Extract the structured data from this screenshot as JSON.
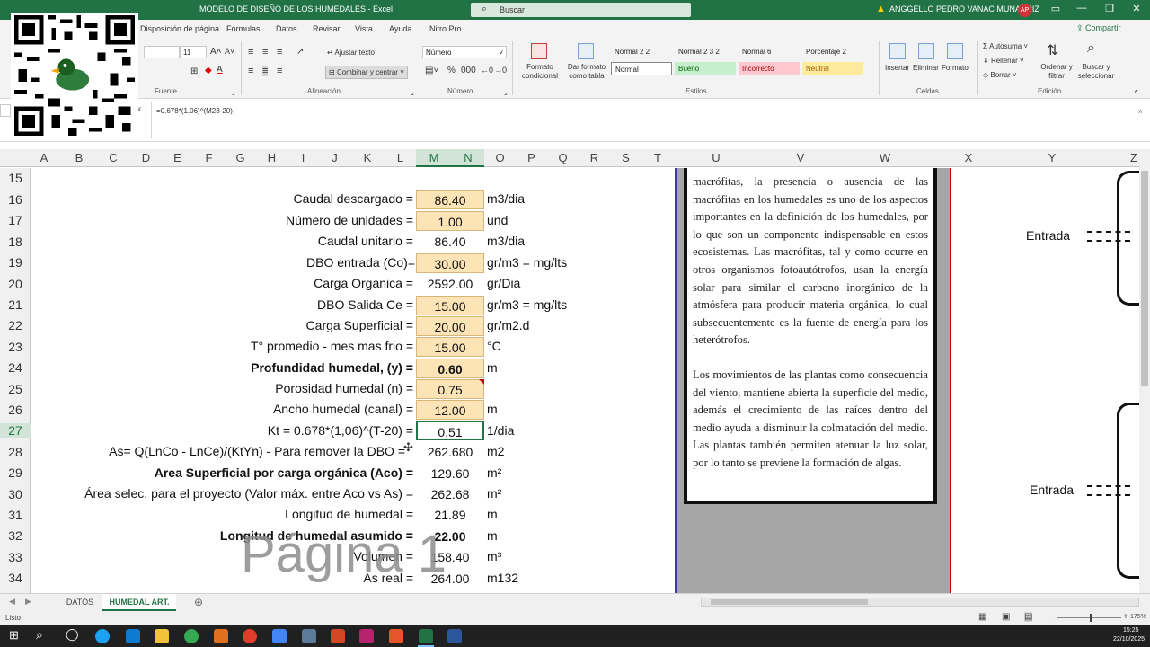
{
  "titlebar": {
    "title": "MODELO DE DISEÑO DE LOS HUMEDALES  -  Excel",
    "search": "Buscar",
    "user": "ANGGELLO PEDRO VANAC MUNARRIZ",
    "avatar": "AP"
  },
  "menu": [
    "Disposición de página",
    "Fórmulas",
    "Datos",
    "Revisar",
    "Vista",
    "Ayuda",
    "Nitro Pro"
  ],
  "share": "Compartir",
  "ribbon": {
    "font_size": "11",
    "fuente": "Fuente",
    "alineacion": "Alineación",
    "ajustar": "Ajustar texto",
    "combinar": "Combinar y centrar",
    "numero_format": "Número",
    "numero": "Número",
    "formato_condicional": "Formato condicional",
    "dar_formato": "Dar formato como tabla",
    "styles_top": [
      "Normal 2 2",
      "Normal 2 3 2",
      "Normal 6",
      "Porcentaje 2"
    ],
    "styles_bottom": [
      "Normal",
      "Bueno",
      "Incorrecto",
      "Neutral"
    ],
    "estilos": "Estilos",
    "insertar": "Insertar",
    "eliminar": "Eliminar",
    "formato": "Formato",
    "celdas": "Celdas",
    "autosuma": "Autosuma",
    "rellenar": "Rellenar",
    "borrar": "Borrar",
    "ordenar": "Ordenar y filtrar",
    "buscar": "Buscar y seleccionar",
    "edicion": "Edición"
  },
  "formula": "=0.678*(1.06)^(M23-20)",
  "columns": [
    "A",
    "B",
    "C",
    "D",
    "E",
    "F",
    "G",
    "H",
    "I",
    "J",
    "K",
    "L",
    "M",
    "N",
    "O",
    "P",
    "Q",
    "R",
    "S",
    "T",
    "U",
    "V",
    "W",
    "X",
    "Y",
    "Z"
  ],
  "rows": [
    {
      "n": "15",
      "label": "",
      "value": "",
      "unit": "",
      "hl": false,
      "bold": false
    },
    {
      "n": "16",
      "label": "Caudal descargado =",
      "value": "86.40",
      "unit": "m3/dia",
      "hl": true,
      "bold": false
    },
    {
      "n": "17",
      "label": "Número de unidades =",
      "value": "1.00",
      "unit": "und",
      "hl": true,
      "bold": false
    },
    {
      "n": "18",
      "label": "Caudal unitario =",
      "value": "86.40",
      "unit": "m3/dia",
      "hl": false,
      "bold": false
    },
    {
      "n": "19",
      "label": "DBO entrada (Co)=",
      "value": "30.00",
      "unit": "gr/m3 = mg/lts",
      "hl": true,
      "bold": false
    },
    {
      "n": "20",
      "label": "Carga Organica =",
      "value": "2592.00",
      "unit": "gr/Dia",
      "hl": false,
      "bold": false
    },
    {
      "n": "21",
      "label": "DBO Salida Ce =",
      "value": "15.00",
      "unit": "gr/m3 = mg/lts",
      "hl": true,
      "bold": false
    },
    {
      "n": "22",
      "label": "Carga Superficial =",
      "value": "20.00",
      "unit": "gr/m2.d",
      "hl": true,
      "bold": false
    },
    {
      "n": "23",
      "label": "T° promedio - mes mas frio =",
      "value": "15.00",
      "unit": "°C",
      "hl": true,
      "bold": false
    },
    {
      "n": "24",
      "label": "Profundidad humedal, (y) =",
      "value": "0.60",
      "unit": "m",
      "hl": true,
      "bold": true
    },
    {
      "n": "25",
      "label": "Porosidad humedal (n) =",
      "value": "0.75",
      "unit": "",
      "hl": true,
      "bold": false
    },
    {
      "n": "26",
      "label": "Ancho humedal (canal) =",
      "value": "12.00",
      "unit": "m",
      "hl": true,
      "bold": false
    },
    {
      "n": "27",
      "label": "Kt = 0.678*(1,06)^(T-20) =",
      "value": "0.51",
      "unit": "1/dia",
      "hl": false,
      "bold": false
    },
    {
      "n": "28",
      "label": "As= Q(LnCo - LnCe)/(KtYn) - Para remover la DBO =",
      "value": "262.680",
      "unit": "m2",
      "hl": false,
      "bold": false
    },
    {
      "n": "29",
      "label": "Area Superficial por carga orgánica (Aco) =",
      "value": "129.60",
      "unit": "m²",
      "hl": false,
      "bold": true
    },
    {
      "n": "30",
      "label": "Área selec. para el proyecto (Valor máx. entre Aco vs As) =",
      "value": "262.68",
      "unit": "m²",
      "hl": false,
      "bold": false
    },
    {
      "n": "31",
      "label": "Longitud de humedal =",
      "value": "21.89",
      "unit": "m",
      "hl": false,
      "bold": false
    },
    {
      "n": "32",
      "label": "Longitud de humedal asumido =",
      "value": "22.00",
      "unit": "m",
      "hl": false,
      "bold": true
    },
    {
      "n": "33",
      "label": "Volumen =",
      "value": "158.40",
      "unit": "m³",
      "hl": false,
      "bold": false
    },
    {
      "n": "34",
      "label": "As real =",
      "value": "264.00",
      "unit": "m132",
      "hl": false,
      "bold": false
    }
  ],
  "watermark": "Página 1",
  "doc_para1": "macrófitas, la presencia o ausencia de las macrófitas en los humedales es uno de los aspectos importantes en la definición de los humedales, por lo que son un componente indispensable en estos ecosistemas. Las macrófitas, tal y como ocurre en otros organismos fotoautótrofos, usan la energía solar para similar el carbono inorgánico de la atmósfera para producir materia orgánica, lo cual subsecuentemente es la fuente de energía para los heterótrofos.",
  "doc_para2": "Los movimientos de las plantas como consecuencia del viento, mantiene abierta la superficie del medio, además el crecimiento de las raíces dentro del medio ayuda a disminuir la colmatación del medio. Las plantas también permiten atenuar la luz solar, por lo tanto se previene la formación de algas.",
  "entrada1": "Entrada",
  "entrada2": "Entrada",
  "tabs": [
    "DATOS",
    "HUMEDAL ART."
  ],
  "status": "Listo",
  "zoom": "175%",
  "clock_time": "15:25",
  "clock_date": "22/10/2025",
  "colors": {
    "excel_green": "#217346",
    "input_fill": "#fce4b7"
  }
}
